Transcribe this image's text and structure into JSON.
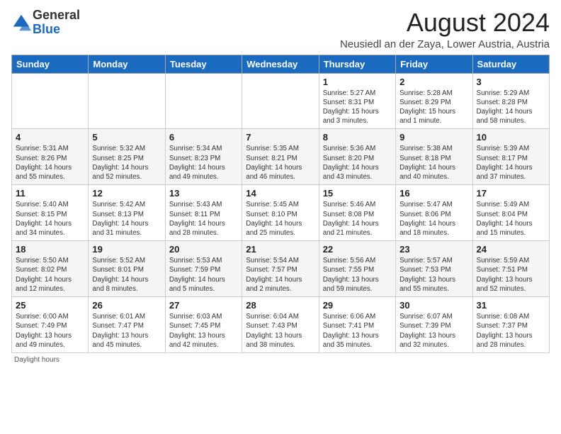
{
  "header": {
    "logo_general": "General",
    "logo_blue": "Blue",
    "main_title": "August 2024",
    "subtitle": "Neusiedl an der Zaya, Lower Austria, Austria"
  },
  "weekdays": [
    "Sunday",
    "Monday",
    "Tuesday",
    "Wednesday",
    "Thursday",
    "Friday",
    "Saturday"
  ],
  "weeks": [
    [
      {
        "day": "",
        "info": ""
      },
      {
        "day": "",
        "info": ""
      },
      {
        "day": "",
        "info": ""
      },
      {
        "day": "",
        "info": ""
      },
      {
        "day": "1",
        "info": "Sunrise: 5:27 AM\nSunset: 8:31 PM\nDaylight: 15 hours\nand 3 minutes."
      },
      {
        "day": "2",
        "info": "Sunrise: 5:28 AM\nSunset: 8:29 PM\nDaylight: 15 hours\nand 1 minute."
      },
      {
        "day": "3",
        "info": "Sunrise: 5:29 AM\nSunset: 8:28 PM\nDaylight: 14 hours\nand 58 minutes."
      }
    ],
    [
      {
        "day": "4",
        "info": "Sunrise: 5:31 AM\nSunset: 8:26 PM\nDaylight: 14 hours\nand 55 minutes."
      },
      {
        "day": "5",
        "info": "Sunrise: 5:32 AM\nSunset: 8:25 PM\nDaylight: 14 hours\nand 52 minutes."
      },
      {
        "day": "6",
        "info": "Sunrise: 5:34 AM\nSunset: 8:23 PM\nDaylight: 14 hours\nand 49 minutes."
      },
      {
        "day": "7",
        "info": "Sunrise: 5:35 AM\nSunset: 8:21 PM\nDaylight: 14 hours\nand 46 minutes."
      },
      {
        "day": "8",
        "info": "Sunrise: 5:36 AM\nSunset: 8:20 PM\nDaylight: 14 hours\nand 43 minutes."
      },
      {
        "day": "9",
        "info": "Sunrise: 5:38 AM\nSunset: 8:18 PM\nDaylight: 14 hours\nand 40 minutes."
      },
      {
        "day": "10",
        "info": "Sunrise: 5:39 AM\nSunset: 8:17 PM\nDaylight: 14 hours\nand 37 minutes."
      }
    ],
    [
      {
        "day": "11",
        "info": "Sunrise: 5:40 AM\nSunset: 8:15 PM\nDaylight: 14 hours\nand 34 minutes."
      },
      {
        "day": "12",
        "info": "Sunrise: 5:42 AM\nSunset: 8:13 PM\nDaylight: 14 hours\nand 31 minutes."
      },
      {
        "day": "13",
        "info": "Sunrise: 5:43 AM\nSunset: 8:11 PM\nDaylight: 14 hours\nand 28 minutes."
      },
      {
        "day": "14",
        "info": "Sunrise: 5:45 AM\nSunset: 8:10 PM\nDaylight: 14 hours\nand 25 minutes."
      },
      {
        "day": "15",
        "info": "Sunrise: 5:46 AM\nSunset: 8:08 PM\nDaylight: 14 hours\nand 21 minutes."
      },
      {
        "day": "16",
        "info": "Sunrise: 5:47 AM\nSunset: 8:06 PM\nDaylight: 14 hours\nand 18 minutes."
      },
      {
        "day": "17",
        "info": "Sunrise: 5:49 AM\nSunset: 8:04 PM\nDaylight: 14 hours\nand 15 minutes."
      }
    ],
    [
      {
        "day": "18",
        "info": "Sunrise: 5:50 AM\nSunset: 8:02 PM\nDaylight: 14 hours\nand 12 minutes."
      },
      {
        "day": "19",
        "info": "Sunrise: 5:52 AM\nSunset: 8:01 PM\nDaylight: 14 hours\nand 8 minutes."
      },
      {
        "day": "20",
        "info": "Sunrise: 5:53 AM\nSunset: 7:59 PM\nDaylight: 14 hours\nand 5 minutes."
      },
      {
        "day": "21",
        "info": "Sunrise: 5:54 AM\nSunset: 7:57 PM\nDaylight: 14 hours\nand 2 minutes."
      },
      {
        "day": "22",
        "info": "Sunrise: 5:56 AM\nSunset: 7:55 PM\nDaylight: 13 hours\nand 59 minutes."
      },
      {
        "day": "23",
        "info": "Sunrise: 5:57 AM\nSunset: 7:53 PM\nDaylight: 13 hours\nand 55 minutes."
      },
      {
        "day": "24",
        "info": "Sunrise: 5:59 AM\nSunset: 7:51 PM\nDaylight: 13 hours\nand 52 minutes."
      }
    ],
    [
      {
        "day": "25",
        "info": "Sunrise: 6:00 AM\nSunset: 7:49 PM\nDaylight: 13 hours\nand 49 minutes."
      },
      {
        "day": "26",
        "info": "Sunrise: 6:01 AM\nSunset: 7:47 PM\nDaylight: 13 hours\nand 45 minutes."
      },
      {
        "day": "27",
        "info": "Sunrise: 6:03 AM\nSunset: 7:45 PM\nDaylight: 13 hours\nand 42 minutes."
      },
      {
        "day": "28",
        "info": "Sunrise: 6:04 AM\nSunset: 7:43 PM\nDaylight: 13 hours\nand 38 minutes."
      },
      {
        "day": "29",
        "info": "Sunrise: 6:06 AM\nSunset: 7:41 PM\nDaylight: 13 hours\nand 35 minutes."
      },
      {
        "day": "30",
        "info": "Sunrise: 6:07 AM\nSunset: 7:39 PM\nDaylight: 13 hours\nand 32 minutes."
      },
      {
        "day": "31",
        "info": "Sunrise: 6:08 AM\nSunset: 7:37 PM\nDaylight: 13 hours\nand 28 minutes."
      }
    ]
  ],
  "footer": {
    "note": "Daylight hours"
  }
}
